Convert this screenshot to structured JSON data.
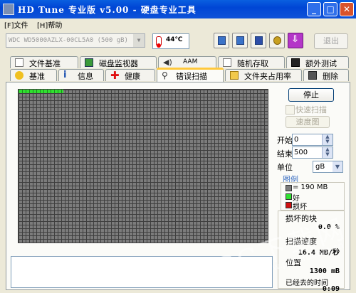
{
  "window": {
    "title": "HD Tune 专业版 v5.00 - 硬盘专业工具"
  },
  "menu": {
    "file": "[F]文件",
    "help": "[H]帮助"
  },
  "toolbar": {
    "drive": "WDC WD5000AZLX-00CL5A0 (500 gB)",
    "temperature": "44℃",
    "exit_label": "退出"
  },
  "tabs_row1": [
    {
      "label": "文件基准",
      "icon": "file-benchmark-icon"
    },
    {
      "label": "磁盘监视器",
      "icon": "disk-monitor-icon"
    },
    {
      "label": "AAM",
      "icon": "speaker-icon"
    },
    {
      "label": "随机存取",
      "icon": "random-access-icon"
    },
    {
      "label": "额外测试",
      "icon": "extra-tests-icon"
    }
  ],
  "tabs_row2": [
    {
      "label": "基准",
      "icon": "benchmark-icon"
    },
    {
      "label": "信息",
      "icon": "info-icon"
    },
    {
      "label": "健康",
      "icon": "health-cross-icon"
    },
    {
      "label": "错误扫描",
      "icon": "magnifier-icon",
      "active": true
    },
    {
      "label": "文件夹占用率",
      "icon": "folder-icon"
    },
    {
      "label": "删除",
      "icon": "trash-icon"
    }
  ],
  "scan": {
    "stop_label": "停止",
    "quick_scan_label": "快速扫描",
    "speed_map_label": "速度图",
    "start_label": "开始",
    "start_value": "0",
    "end_label": "结束",
    "end_value": "500",
    "unit_label": "单位",
    "unit_value": "gB",
    "progress_fraction": 0.18
  },
  "legend": {
    "title": "图例",
    "block_size": "= 190 MB",
    "good": "好",
    "bad": "损坏",
    "good_color": "#30E030",
    "bad_color": "#D01010"
  },
  "stats": {
    "damaged_label": "损坏的块",
    "damaged_value": "0.0 %",
    "speed_label": "扫描速度",
    "speed_value": "16.4 MB/秒",
    "position_label": "位置",
    "position_value": "1300 mB",
    "elapsed_label": "已经去的时间",
    "elapsed_value": "0:09"
  },
  "watermark": {
    "text": "PC下载网",
    "url": "www.pcsoft.com.cn"
  }
}
